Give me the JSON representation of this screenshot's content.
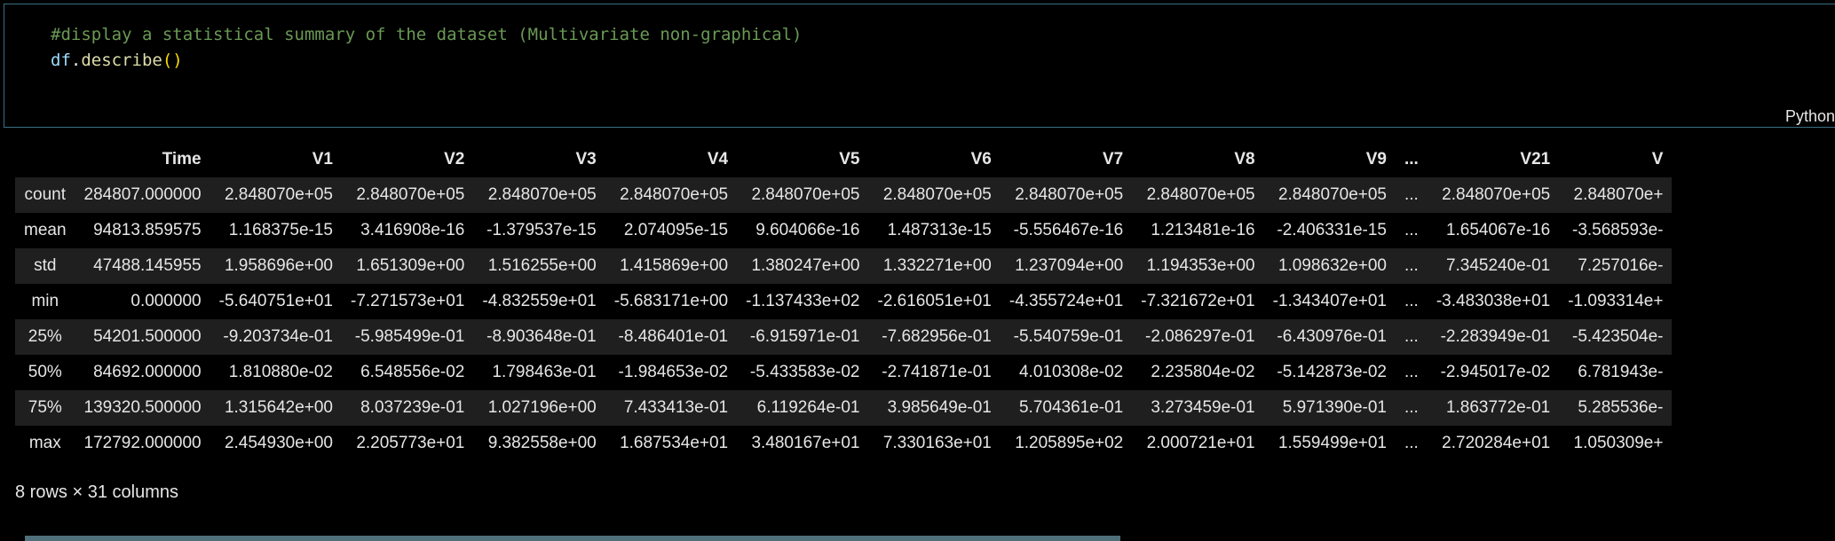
{
  "cell": {
    "comment": "#display a statistical summary of the dataset (Multivariate non-graphical)",
    "code_obj": "df",
    "code_dot": ".",
    "code_fn": "describe",
    "code_paren": "()",
    "language": "Python"
  },
  "table": {
    "columns": [
      "",
      "Time",
      "V1",
      "V2",
      "V3",
      "V4",
      "V5",
      "V6",
      "V7",
      "V8",
      "V9",
      "...",
      "V21",
      "V"
    ],
    "rows": [
      [
        "count",
        "284807.000000",
        "2.848070e+05",
        "2.848070e+05",
        "2.848070e+05",
        "2.848070e+05",
        "2.848070e+05",
        "2.848070e+05",
        "2.848070e+05",
        "2.848070e+05",
        "2.848070e+05",
        "...",
        "2.848070e+05",
        "2.848070e+"
      ],
      [
        "mean",
        "94813.859575",
        "1.168375e-15",
        "3.416908e-16",
        "-1.379537e-15",
        "2.074095e-15",
        "9.604066e-16",
        "1.487313e-15",
        "-5.556467e-16",
        "1.213481e-16",
        "-2.406331e-15",
        "...",
        "1.654067e-16",
        "-3.568593e-"
      ],
      [
        "std",
        "47488.145955",
        "1.958696e+00",
        "1.651309e+00",
        "1.516255e+00",
        "1.415869e+00",
        "1.380247e+00",
        "1.332271e+00",
        "1.237094e+00",
        "1.194353e+00",
        "1.098632e+00",
        "...",
        "7.345240e-01",
        "7.257016e-"
      ],
      [
        "min",
        "0.000000",
        "-5.640751e+01",
        "-7.271573e+01",
        "-4.832559e+01",
        "-5.683171e+00",
        "-1.137433e+02",
        "-2.616051e+01",
        "-4.355724e+01",
        "-7.321672e+01",
        "-1.343407e+01",
        "...",
        "-3.483038e+01",
        "-1.093314e+"
      ],
      [
        "25%",
        "54201.500000",
        "-9.203734e-01",
        "-5.985499e-01",
        "-8.903648e-01",
        "-8.486401e-01",
        "-6.915971e-01",
        "-7.682956e-01",
        "-5.540759e-01",
        "-2.086297e-01",
        "-6.430976e-01",
        "...",
        "-2.283949e-01",
        "-5.423504e-"
      ],
      [
        "50%",
        "84692.000000",
        "1.810880e-02",
        "6.548556e-02",
        "1.798463e-01",
        "-1.984653e-02",
        "-5.433583e-02",
        "-2.741871e-01",
        "4.010308e-02",
        "2.235804e-02",
        "-5.142873e-02",
        "...",
        "-2.945017e-02",
        "6.781943e-"
      ],
      [
        "75%",
        "139320.500000",
        "1.315642e+00",
        "8.037239e-01",
        "1.027196e+00",
        "7.433413e-01",
        "6.119264e-01",
        "3.985649e-01",
        "5.704361e-01",
        "3.273459e-01",
        "5.971390e-01",
        "...",
        "1.863772e-01",
        "5.285536e-"
      ],
      [
        "max",
        "172792.000000",
        "2.454930e+00",
        "2.205773e+01",
        "9.382558e+00",
        "1.687534e+01",
        "3.480167e+01",
        "7.330163e+01",
        "1.205895e+02",
        "2.000721e+01",
        "1.559499e+01",
        "...",
        "2.720284e+01",
        "1.050309e+"
      ]
    ]
  },
  "footer": "8 rows × 31 columns"
}
